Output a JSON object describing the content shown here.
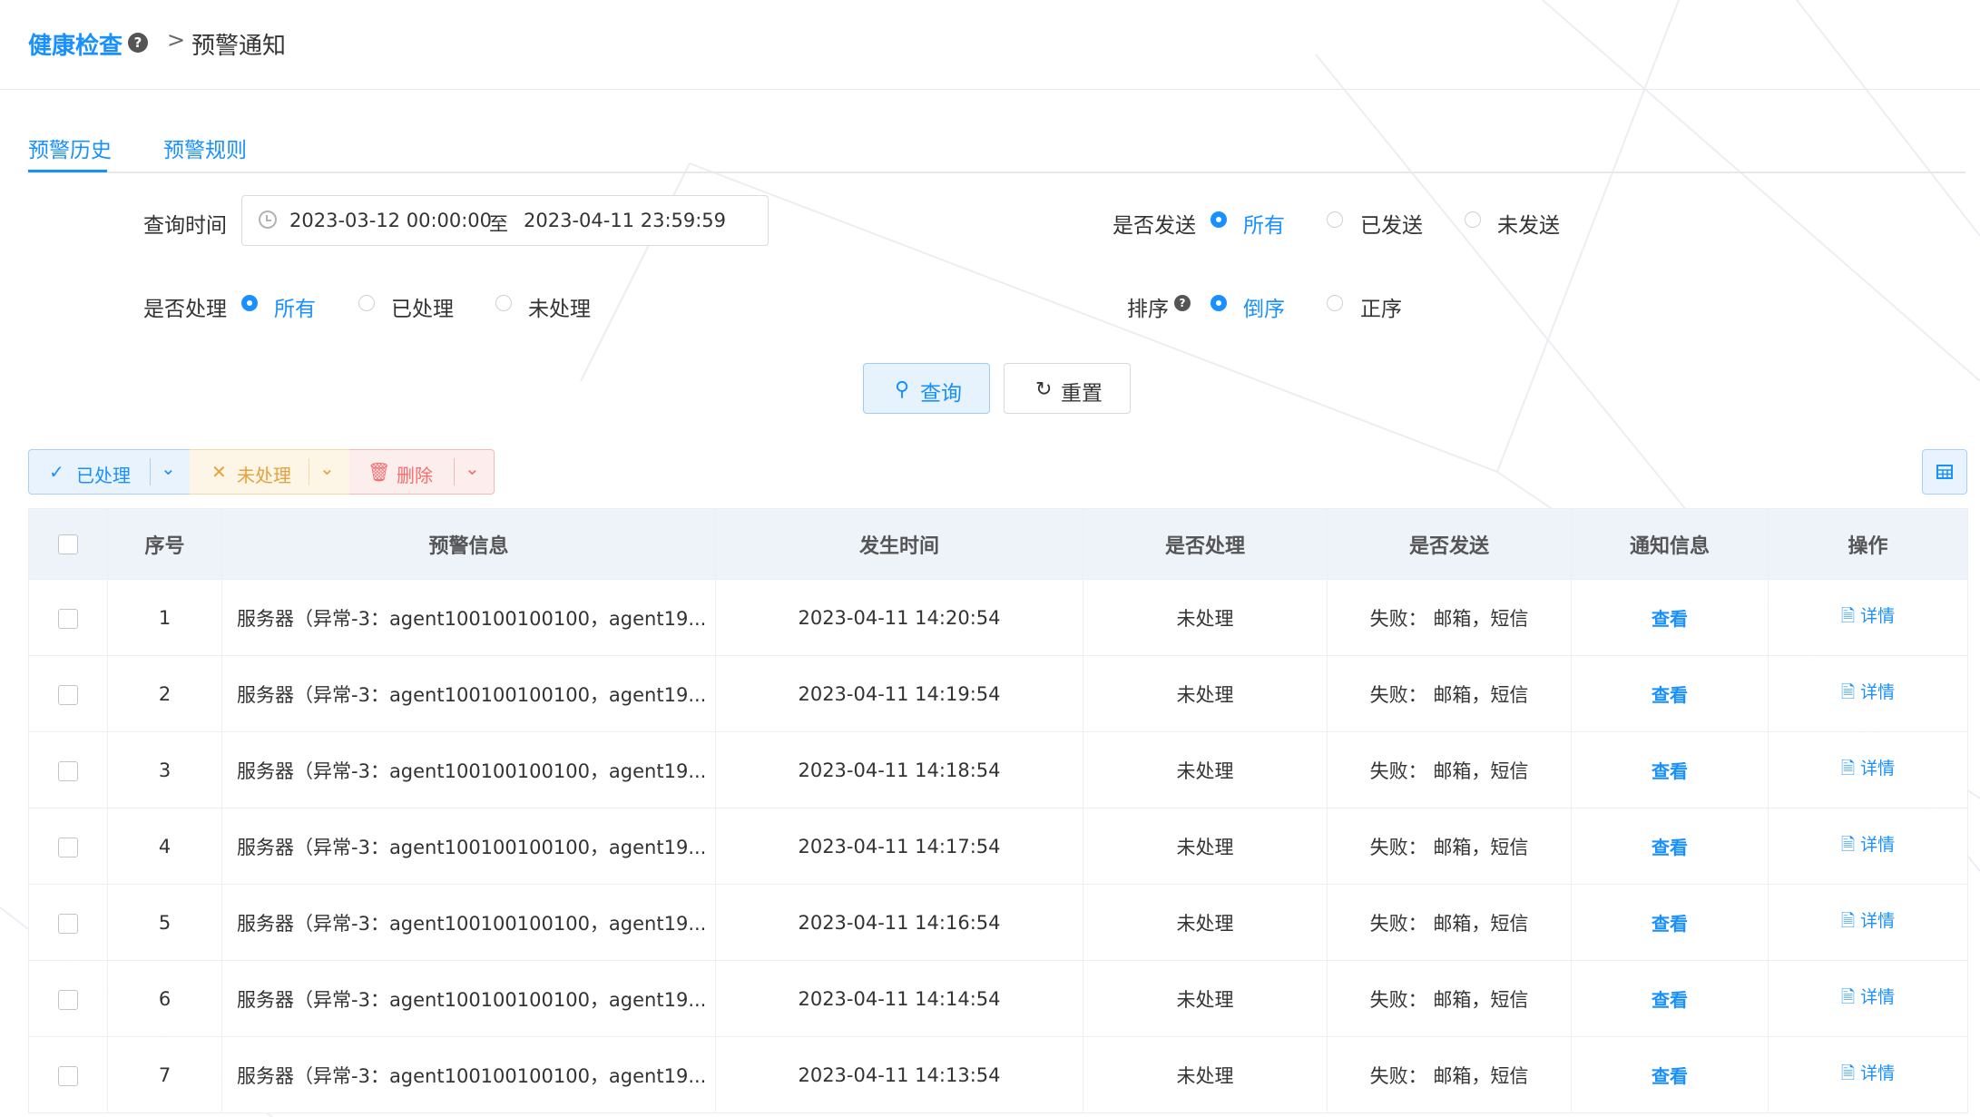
{
  "breadcrumb": {
    "root": "健康检查",
    "help": "?",
    "separator": ">",
    "current": "预警通知"
  },
  "tabs": [
    {
      "label": "预警历史"
    },
    {
      "label": "预警规则"
    }
  ],
  "filters": {
    "time_label": "查询时间",
    "start": "2023-03-12 00:00:00",
    "to": "至",
    "end": "2023-04-11 23:59:59",
    "sent_label": "是否发送",
    "sent_options": [
      "所有",
      "已发送",
      "未发送"
    ],
    "sent_selected": "所有",
    "handled_label": "是否处理",
    "handled_options": [
      "所有",
      "已处理",
      "未处理"
    ],
    "handled_selected": "所有",
    "sort_label": "排序",
    "sort_help": "?",
    "sort_options": [
      "倒序",
      "正序"
    ],
    "sort_selected": "倒序"
  },
  "buttons": {
    "query": "查询",
    "reset": "重置"
  },
  "actions": {
    "handled": "已处理",
    "unhandled": "未处理",
    "delete": "删除"
  },
  "table": {
    "headers": [
      "序号",
      "预警信息",
      "发生时间",
      "是否处理",
      "是否发送",
      "通知信息",
      "操作"
    ],
    "rows": [
      {
        "idx": "1",
        "info": "服务器（异常-3：agent100100100100，agent19...",
        "time": "2023-04-11 14:20:54",
        "handled": "未处理",
        "sent": "失败：  邮箱，短信",
        "notice": "查看",
        "op": "详情"
      },
      {
        "idx": "2",
        "info": "服务器（异常-3：agent100100100100，agent19...",
        "time": "2023-04-11 14:19:54",
        "handled": "未处理",
        "sent": "失败：  邮箱，短信",
        "notice": "查看",
        "op": "详情"
      },
      {
        "idx": "3",
        "info": "服务器（异常-3：agent100100100100，agent19...",
        "time": "2023-04-11 14:18:54",
        "handled": "未处理",
        "sent": "失败：  邮箱，短信",
        "notice": "查看",
        "op": "详情"
      },
      {
        "idx": "4",
        "info": "服务器（异常-3：agent100100100100，agent19...",
        "time": "2023-04-11 14:17:54",
        "handled": "未处理",
        "sent": "失败：  邮箱，短信",
        "notice": "查看",
        "op": "详情"
      },
      {
        "idx": "5",
        "info": "服务器（异常-3：agent100100100100，agent19...",
        "time": "2023-04-11 14:16:54",
        "handled": "未处理",
        "sent": "失败：  邮箱，短信",
        "notice": "查看",
        "op": "详情"
      },
      {
        "idx": "6",
        "info": "服务器（异常-3：agent100100100100，agent19...",
        "time": "2023-04-11 14:14:54",
        "handled": "未处理",
        "sent": "失败：  邮箱，短信",
        "notice": "查看",
        "op": "详情"
      },
      {
        "idx": "7",
        "info": "服务器（异常-3：agent100100100100，agent19...",
        "time": "2023-04-11 14:13:54",
        "handled": "未处理",
        "sent": "失败：  邮箱，短信",
        "notice": "查看",
        "op": "详情"
      }
    ]
  },
  "colors": {
    "accent": "#1890ff",
    "danger": "#f5222d",
    "warning": "#e6a23c"
  }
}
